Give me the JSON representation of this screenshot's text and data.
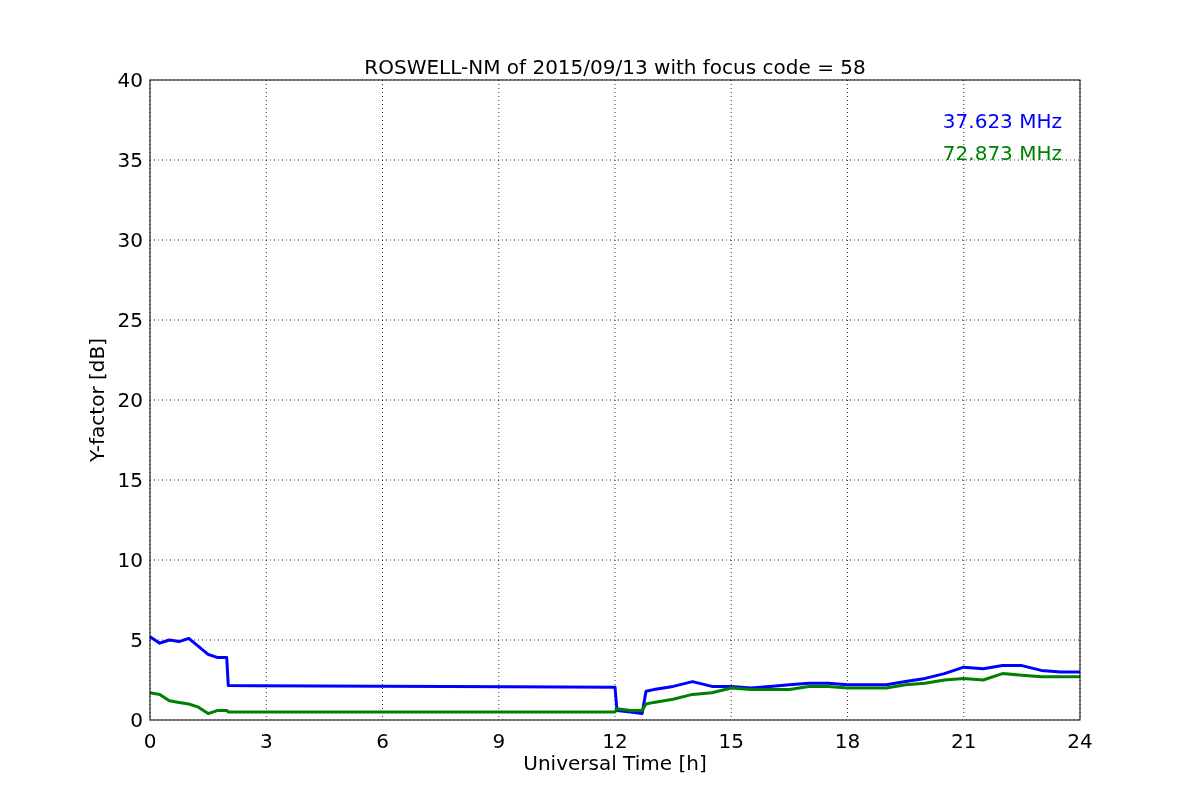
{
  "chart_data": {
    "type": "line",
    "title": "ROSWELL-NM of 2015/09/13 with focus code = 58",
    "xlabel": "Universal Time [h]",
    "ylabel": "Y-factor [dB]",
    "x": [
      0,
      0.25,
      0.5,
      0.75,
      1,
      1.25,
      1.5,
      1.75,
      1.98,
      2.02,
      12,
      12.05,
      12.4,
      12.7,
      12.8,
      13,
      13.5,
      14,
      14.5,
      15,
      15.5,
      16,
      16.5,
      17,
      17.5,
      18,
      18.5,
      19,
      19.5,
      20,
      20.5,
      21,
      21.5,
      22,
      22.5,
      23,
      23.5,
      24
    ],
    "series": [
      {
        "name": "37.623 MHz",
        "color": "#0000ff",
        "values": [
          5.2,
          4.8,
          5.0,
          4.9,
          5.1,
          4.6,
          4.1,
          3.9,
          3.9,
          2.15,
          2.05,
          0.6,
          0.5,
          0.4,
          1.8,
          1.9,
          2.1,
          2.4,
          2.1,
          2.1,
          2.0,
          2.1,
          2.2,
          2.3,
          2.3,
          2.2,
          2.2,
          2.2,
          2.4,
          2.6,
          2.9,
          3.3,
          3.2,
          3.4,
          3.4,
          3.1,
          3.0,
          3.0
        ]
      },
      {
        "name": "72.873 MHz",
        "color": "#008000",
        "values": [
          1.7,
          1.6,
          1.2,
          1.1,
          1.0,
          0.8,
          0.4,
          0.6,
          0.6,
          0.5,
          0.5,
          0.7,
          0.6,
          0.6,
          1.0,
          1.1,
          1.3,
          1.6,
          1.7,
          2.0,
          1.9,
          1.9,
          1.9,
          2.1,
          2.1,
          2.0,
          2.0,
          2.0,
          2.2,
          2.3,
          2.5,
          2.6,
          2.5,
          2.9,
          2.8,
          2.7,
          2.7,
          2.7
        ]
      }
    ],
    "grid": true,
    "xlim": [
      0,
      24
    ],
    "ylim": [
      0,
      40
    ],
    "xticks": [
      0,
      3,
      6,
      9,
      12,
      15,
      18,
      21,
      24
    ],
    "yticks": [
      0,
      5,
      10,
      15,
      20,
      25,
      30,
      35,
      40
    ]
  }
}
